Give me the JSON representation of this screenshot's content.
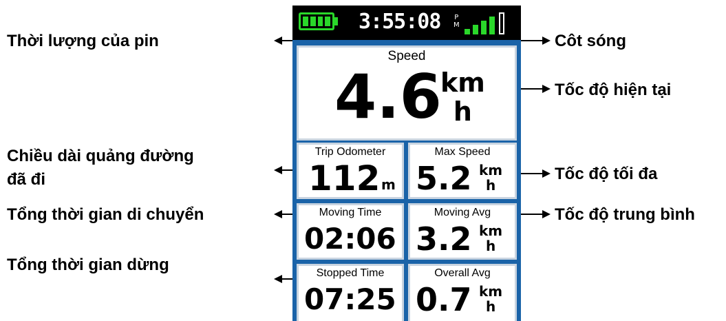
{
  "device": {
    "time": "3:55:08",
    "ampm_top": "P",
    "ampm_bottom": "M",
    "battery_color": "#2ad82a",
    "signal_bars_filled": 4,
    "signal_bars_total": 5
  },
  "fields": {
    "speed": {
      "label": "Speed",
      "value": "4.6",
      "unit_top": "km",
      "unit_bottom": "h"
    },
    "trip_odometer": {
      "label": "Trip Odometer",
      "value": "112",
      "unit": "m"
    },
    "max_speed": {
      "label": "Max Speed",
      "value": "5.2",
      "unit_top": "km",
      "unit_bottom": "h"
    },
    "moving_time": {
      "label": "Moving Time",
      "value": "02:06"
    },
    "moving_avg": {
      "label": "Moving Avg",
      "value": "3.2",
      "unit_top": "km",
      "unit_bottom": "h"
    },
    "stopped_time": {
      "label": "Stopped Time",
      "value": "07:25"
    },
    "overall_avg": {
      "label": "Overall Avg",
      "value": "0.7",
      "unit_top": "km",
      "unit_bottom": "h"
    }
  },
  "annotations": {
    "battery": "Thời lượng của pin",
    "signal": "Côt sóng",
    "current_speed": "Tốc độ hiện tại",
    "trip_distance_line1": "Chiều dài quảng đường",
    "trip_distance_line2": "đã đi",
    "max_speed": "Tốc độ tối đa",
    "moving_time": "Tổng thời gian di chuyển",
    "moving_avg": "Tốc độ trung bình",
    "stopped_time": "Tổng thời gian dừng"
  }
}
